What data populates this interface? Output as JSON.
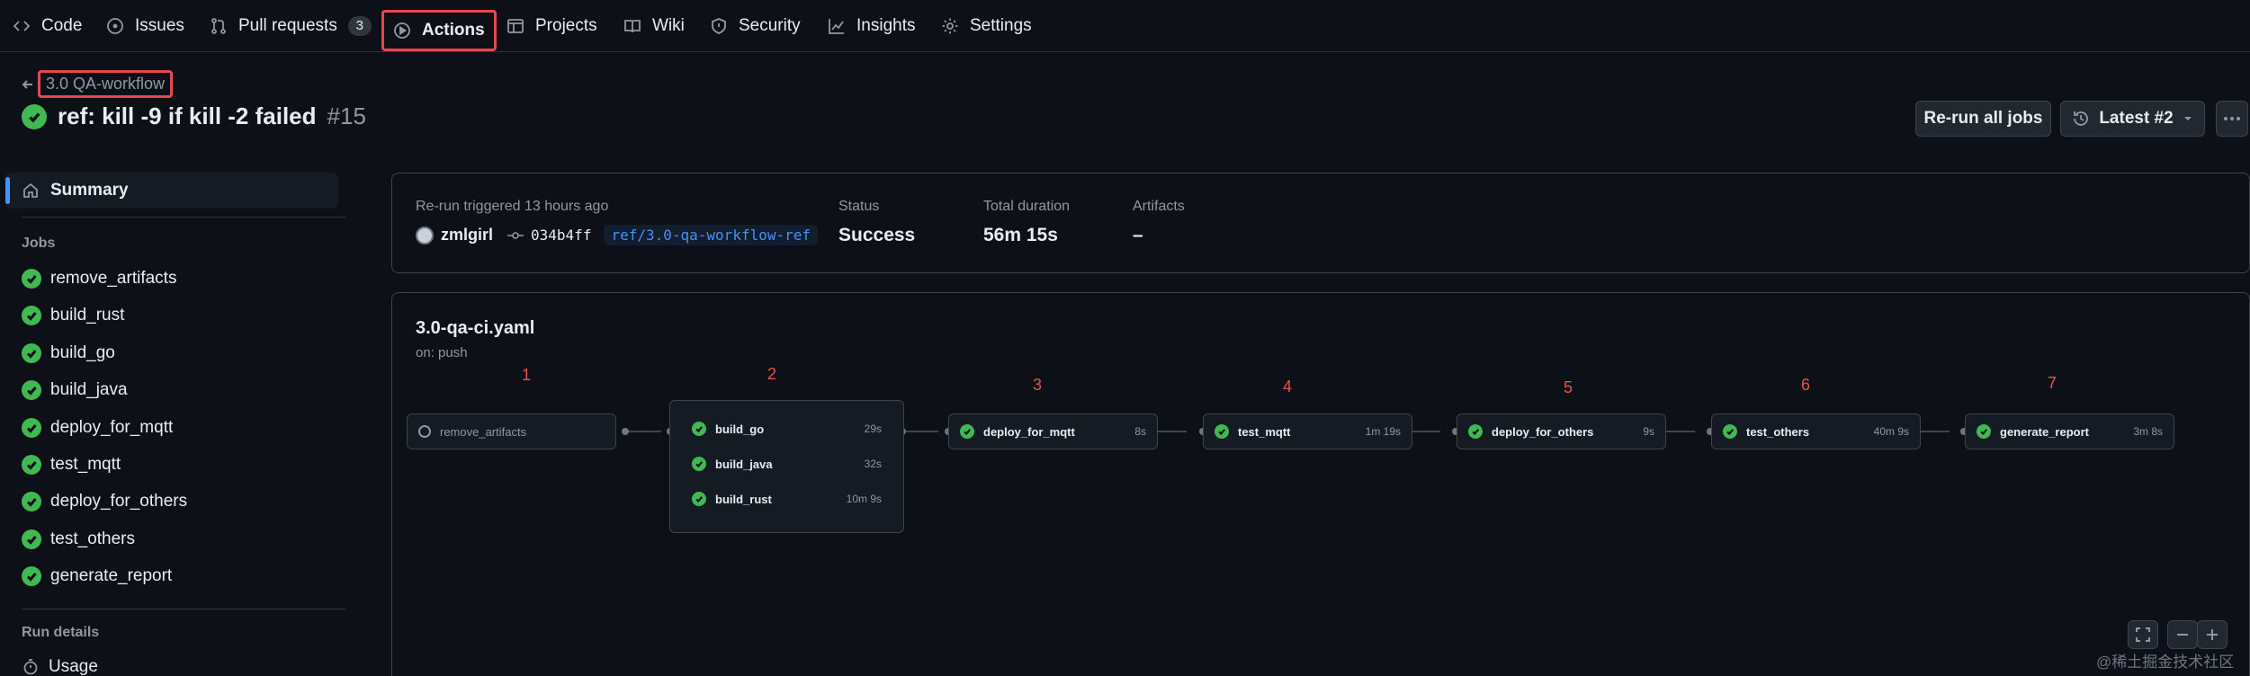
{
  "nav": {
    "code": "Code",
    "issues": "Issues",
    "pull_requests": "Pull requests",
    "pull_requests_count": "3",
    "actions": "Actions",
    "projects": "Projects",
    "wiki": "Wiki",
    "security": "Security",
    "insights": "Insights",
    "settings": "Settings"
  },
  "header": {
    "workflow_name": "3.0 QA-workflow",
    "run_title": "ref: kill -9 if kill -2 failed",
    "run_number": "#15",
    "rerun_button": "Re-run all jobs",
    "attempt_button": "Latest #2"
  },
  "sidebar": {
    "summary": "Summary",
    "jobs_heading": "Jobs",
    "jobs": [
      "remove_artifacts",
      "build_rust",
      "build_go",
      "build_java",
      "deploy_for_mqtt",
      "test_mqtt",
      "deploy_for_others",
      "test_others",
      "generate_report"
    ],
    "run_details_heading": "Run details",
    "usage": "Usage"
  },
  "summary_card": {
    "trigger": "Re-run triggered 13 hours ago",
    "user": "zmlgirl",
    "commit": "034b4ff",
    "branch": "ref/3.0-qa-workflow-ref",
    "status_label": "Status",
    "status_value": "Success",
    "duration_label": "Total duration",
    "duration_value": "56m 15s",
    "artifacts_label": "Artifacts",
    "artifacts_value": "–"
  },
  "workflow": {
    "file": "3.0-qa-ci.yaml",
    "trigger": "on: push",
    "stage_numbers": [
      "1",
      "2",
      "3",
      "4",
      "5",
      "6",
      "7"
    ],
    "stage1": {
      "name": "remove_artifacts"
    },
    "stage2": [
      {
        "name": "build_go",
        "duration": "29s"
      },
      {
        "name": "build_java",
        "duration": "32s"
      },
      {
        "name": "build_rust",
        "duration": "10m 9s"
      }
    ],
    "stage3": {
      "name": "deploy_for_mqtt",
      "duration": "8s"
    },
    "stage4": {
      "name": "test_mqtt",
      "duration": "1m 19s"
    },
    "stage5": {
      "name": "deploy_for_others",
      "duration": "9s"
    },
    "stage6": {
      "name": "test_others",
      "duration": "40m 9s"
    },
    "stage7": {
      "name": "generate_report",
      "duration": "3m 8s"
    }
  },
  "watermark": "@稀土掘金技术社区",
  "colors": {
    "success": "#3fb950",
    "annotation": "#e5484d",
    "accent": "#4493f8"
  }
}
